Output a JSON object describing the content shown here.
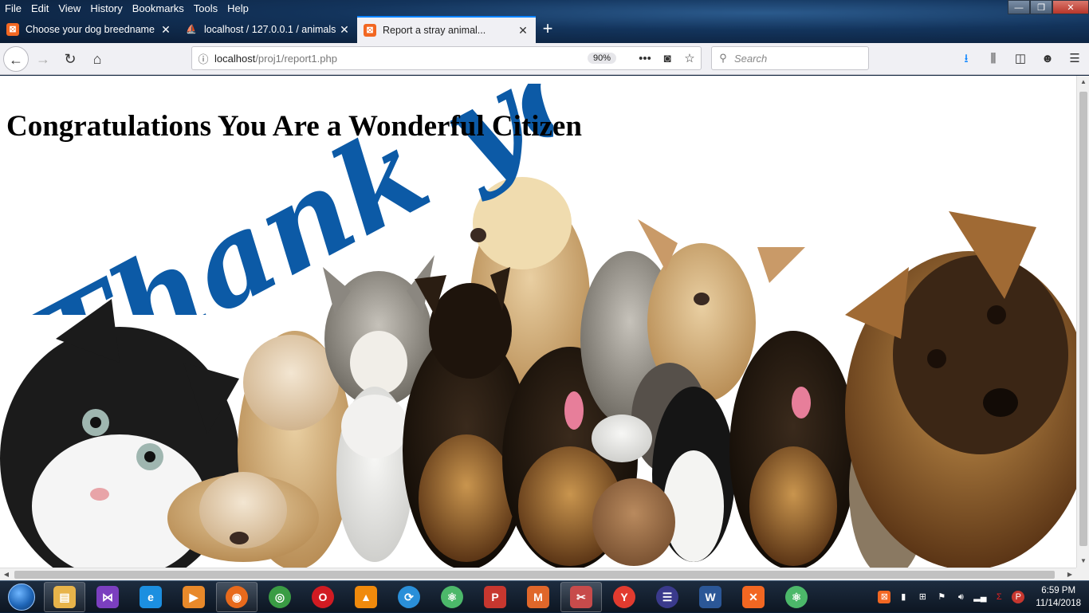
{
  "menubar": [
    "File",
    "Edit",
    "View",
    "History",
    "Bookmarks",
    "Tools",
    "Help"
  ],
  "window_controls": {
    "minimize": "—",
    "maximize": "❐",
    "close": "✕"
  },
  "tabs": [
    {
      "label": "Choose your dog breedname",
      "favicon_color": "#f26722",
      "active": false
    },
    {
      "label": "localhost / 127.0.0.1 / animals /",
      "favicon_color": "#e8a23b",
      "active": false
    },
    {
      "label": "Report a stray animal...",
      "favicon_color": "#f26722",
      "active": true
    }
  ],
  "toolbar": {
    "url_host": "localhost",
    "url_path": "/proj1/report1.php",
    "zoom": "90%",
    "search_placeholder": "Search"
  },
  "page": {
    "heading": "Congratulations You Are a Wonderful Citizen",
    "banner_text": "Thank you!",
    "accent_color": "#0c5aa6"
  },
  "taskbar": {
    "apps": [
      {
        "name": "file-explorer",
        "color": "#e8b44a",
        "glyph": "▤",
        "open": true
      },
      {
        "name": "visual-studio",
        "color": "#7b3fbf",
        "glyph": "⋈",
        "open": false
      },
      {
        "name": "internet-explorer",
        "color": "#1c8fe0",
        "glyph": "e",
        "open": false
      },
      {
        "name": "media-player",
        "color": "#e8892a",
        "glyph": "▶",
        "open": false
      },
      {
        "name": "firefox",
        "color": "#e86a1c",
        "glyph": "◉",
        "open": true
      },
      {
        "name": "chrome",
        "color": "#3a9c44",
        "glyph": "◎",
        "open": false
      },
      {
        "name": "opera",
        "color": "#d11b22",
        "glyph": "O",
        "open": false
      },
      {
        "name": "vlc",
        "color": "#f08a0c",
        "glyph": "▲",
        "open": false
      },
      {
        "name": "sync-app",
        "color": "#2a8fd9",
        "glyph": "⟳",
        "open": false
      },
      {
        "name": "atom-editor",
        "color": "#4cb86a",
        "glyph": "⚛",
        "open": false
      },
      {
        "name": "p-app",
        "color": "#c7372f",
        "glyph": "P",
        "open": false
      },
      {
        "name": "matlab",
        "color": "#e0672a",
        "glyph": "M",
        "open": false
      },
      {
        "name": "snipping-tool",
        "color": "#c74b4b",
        "glyph": "✂",
        "open": true
      },
      {
        "name": "yandex",
        "color": "#e23b2f",
        "glyph": "Y",
        "open": false
      },
      {
        "name": "eclipse",
        "color": "#3a3a8c",
        "glyph": "☰",
        "open": false
      },
      {
        "name": "word",
        "color": "#2b5797",
        "glyph": "W",
        "open": false
      },
      {
        "name": "xampp",
        "color": "#f26722",
        "glyph": "✕",
        "open": false
      },
      {
        "name": "atom-editor-2",
        "color": "#4cb86a",
        "glyph": "⚛",
        "open": false
      }
    ],
    "time": "6:59 PM",
    "date": "11/14/2018"
  }
}
